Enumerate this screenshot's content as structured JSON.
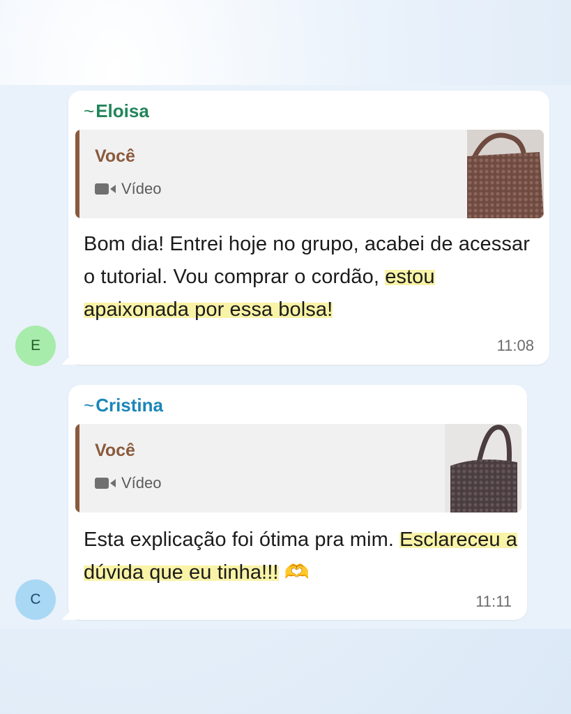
{
  "messages": [
    {
      "sender": "Eloisa",
      "sender_prefix": "~",
      "sender_color": "#22855a",
      "avatar_letter": "E",
      "avatar_color": "#a7ecaa",
      "quote": {
        "author": "Você",
        "type": "Vídeo",
        "media_icon": "video-camera-icon"
      },
      "text_plain": "Bom dia! Entrei hoje no grupo, acabei de acessar o tutorial. Vou comprar o cordão, ",
      "text_highlighted": "estou apaixonada por essa bolsa!",
      "time": "11:08"
    },
    {
      "sender": "Cristina",
      "sender_prefix": "~",
      "sender_color": "#1a86b8",
      "avatar_letter": "C",
      "avatar_color": "#a9d8f5",
      "quote": {
        "author": "Você",
        "type": "Vídeo",
        "media_icon": "video-camera-icon"
      },
      "text_plain": "Esta explicação foi ótima pra mim. ",
      "text_highlighted": "Esclareceu a dúvida que eu tinha!!!",
      "emoji": "🫶",
      "time": "11:11"
    }
  ],
  "colors": {
    "highlight": "#f8f3a6",
    "quote_bar": "#8a5a3c",
    "bubble": "#ffffff",
    "background": "#e9f1fa"
  }
}
